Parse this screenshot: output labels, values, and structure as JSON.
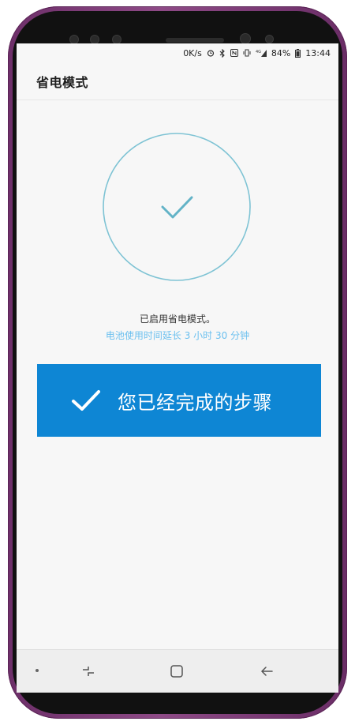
{
  "status_bar": {
    "network_speed": "0K/s",
    "battery": "84%",
    "time": "13:44",
    "icons": [
      "alarm-icon",
      "bluetooth-icon",
      "nfc-icon",
      "vibrate-icon",
      "signal-icon",
      "battery-icon"
    ]
  },
  "app_bar": {
    "title": "省电模式"
  },
  "status": {
    "check_icon": "check-icon",
    "message": "已启用省电模式。",
    "extension": "电池使用时间延长 3 小时 30 分钟"
  },
  "banner": {
    "label": "您已经完成的步骤",
    "icon": "check-icon"
  },
  "nav_bar": {
    "items": [
      "dot-icon",
      "recents-icon",
      "home-icon",
      "back-icon"
    ]
  },
  "colors": {
    "phone_frame": "#7a3b74",
    "accent_circle": "#7ec3d4",
    "secondary_text": "#6cc0ef",
    "banner_bg": "#0e86d4"
  }
}
